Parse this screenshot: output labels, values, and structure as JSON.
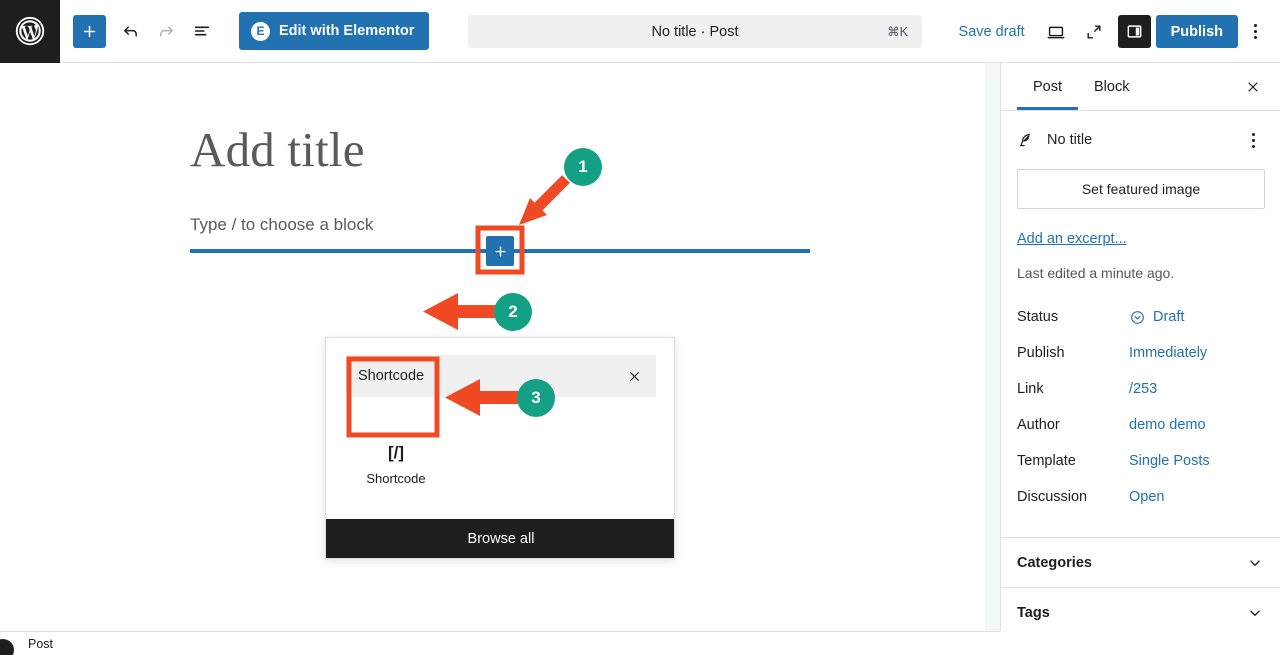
{
  "topbar": {
    "logo_icon": "wordpress-logo-icon",
    "inserter_icon": "plus-icon",
    "undo_icon": "undo-arrow-icon",
    "redo_icon": "redo-arrow-icon",
    "overview_icon": "document-overview-icon",
    "elementor_label": "Edit with Elementor",
    "elementor_badge": "E",
    "document_title": "No title · Post",
    "command_shortcut": "⌘K",
    "save_draft_label": "Save draft",
    "preview_icon": "desktop-preview-icon",
    "fullscreen_icon": "expand-view-icon",
    "sidebar_toggle_icon": "settings-panel-icon",
    "publish_label": "Publish",
    "options_icon": "kebab-menu-icon"
  },
  "canvas": {
    "title_placeholder": "Add title",
    "block_placeholder": "Type / to choose a block",
    "insert_plus_icon": "plus-icon"
  },
  "inserter_popup": {
    "search_value": "Shortcode",
    "close_icon": "close-x-icon",
    "block": {
      "icon_glyph": "[/]",
      "icon_name": "shortcode-icon",
      "label": "Shortcode"
    },
    "browse_all_label": "Browse all"
  },
  "annotations": {
    "accent_green": "#14a085",
    "accent_orange": "#f04a24",
    "markers": [
      {
        "number": "1",
        "target": "block-inserter-plus-button"
      },
      {
        "number": "2",
        "target": "inserter-search-field"
      },
      {
        "number": "3",
        "target": "shortcode-block-item"
      }
    ]
  },
  "sidebar": {
    "tabs": [
      {
        "label": "Post",
        "active": true
      },
      {
        "label": "Block",
        "active": false
      }
    ],
    "close_icon": "close-x-icon",
    "document_icon": "quill-pen-icon",
    "document_title": "No title",
    "document_options_icon": "kebab-menu-icon",
    "featured_image_label": "Set featured image",
    "excerpt_link": "Add an excerpt...",
    "last_edited": "Last edited a minute ago.",
    "meta": [
      {
        "label": "Status",
        "value": "Draft",
        "icon": "draft-circle-icon"
      },
      {
        "label": "Publish",
        "value": "Immediately",
        "icon": ""
      },
      {
        "label": "Link",
        "value": "/253",
        "icon": ""
      },
      {
        "label": "Author",
        "value": "demo demo",
        "icon": ""
      },
      {
        "label": "Template",
        "value": "Single Posts",
        "icon": ""
      },
      {
        "label": "Discussion",
        "value": "Open",
        "icon": ""
      }
    ],
    "panels": [
      {
        "label": "Categories",
        "chevron": "chevron-down-icon"
      },
      {
        "label": "Tags",
        "chevron": "chevron-down-icon"
      }
    ]
  },
  "bottombar": {
    "breadcrumb": "Post"
  }
}
